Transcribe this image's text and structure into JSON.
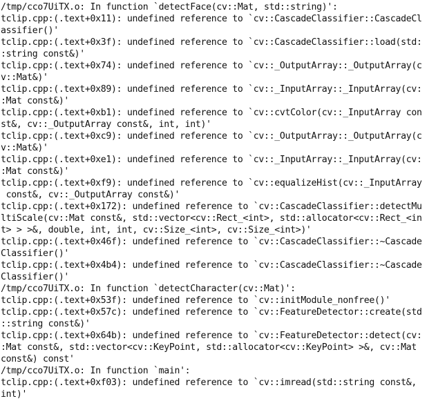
{
  "terminal": {
    "lines": [
      "/tmp/cco7UiTX.o: In function `detectFace(cv::Mat, std::string)':",
      "tclip.cpp:(.text+0x11): undefined reference to `cv::CascadeClassifier::CascadeCl",
      "assifier()'",
      "tclip.cpp:(.text+0x3f): undefined reference to `cv::CascadeClassifier::load(std:",
      ":string const&)'",
      "tclip.cpp:(.text+0x74): undefined reference to `cv::_OutputArray::_OutputArray(c",
      "v::Mat&)'",
      "tclip.cpp:(.text+0x89): undefined reference to `cv::_InputArray::_InputArray(cv:",
      ":Mat const&)'",
      "tclip.cpp:(.text+0xb1): undefined reference to `cv::cvtColor(cv::_InputArray con",
      "st&, cv::_OutputArray const&, int, int)'",
      "tclip.cpp:(.text+0xc9): undefined reference to `cv::_OutputArray::_OutputArray(c",
      "v::Mat&)'",
      "tclip.cpp:(.text+0xe1): undefined reference to `cv::_InputArray::_InputArray(cv:",
      ":Mat const&)'",
      "tclip.cpp:(.text+0xf9): undefined reference to `cv::equalizeHist(cv::_InputArray",
      " const&, cv::_OutputArray const&)'",
      "tclip.cpp:(.text+0x172): undefined reference to `cv::CascadeClassifier::detectMu",
      "ltiScale(cv::Mat const&, std::vector<cv::Rect_<int>, std::allocator<cv::Rect_<in",
      "t> > >&, double, int, int, cv::Size_<int>, cv::Size_<int>)'",
      "tclip.cpp:(.text+0x46f): undefined reference to `cv::CascadeClassifier::~Cascade",
      "Classifier()'",
      "tclip.cpp:(.text+0x4b4): undefined reference to `cv::CascadeClassifier::~Cascade",
      "Classifier()'",
      "/tmp/cco7UiTX.o: In function `detectCharacter(cv::Mat)':",
      "tclip.cpp:(.text+0x53f): undefined reference to `cv::initModule_nonfree()'",
      "tclip.cpp:(.text+0x57c): undefined reference to `cv::FeatureDetector::create(std",
      "::string const&)'",
      "tclip.cpp:(.text+0x64b): undefined reference to `cv::FeatureDetector::detect(cv:",
      ":Mat const&, std::vector<cv::KeyPoint, std::allocator<cv::KeyPoint> >&, cv::Mat",
      "const&) const'",
      "/tmp/cco7UiTX.o: In function `main':",
      "tclip.cpp:(.text+0xf03): undefined reference to `cv::imread(std::string const&,",
      "int)'"
    ]
  }
}
